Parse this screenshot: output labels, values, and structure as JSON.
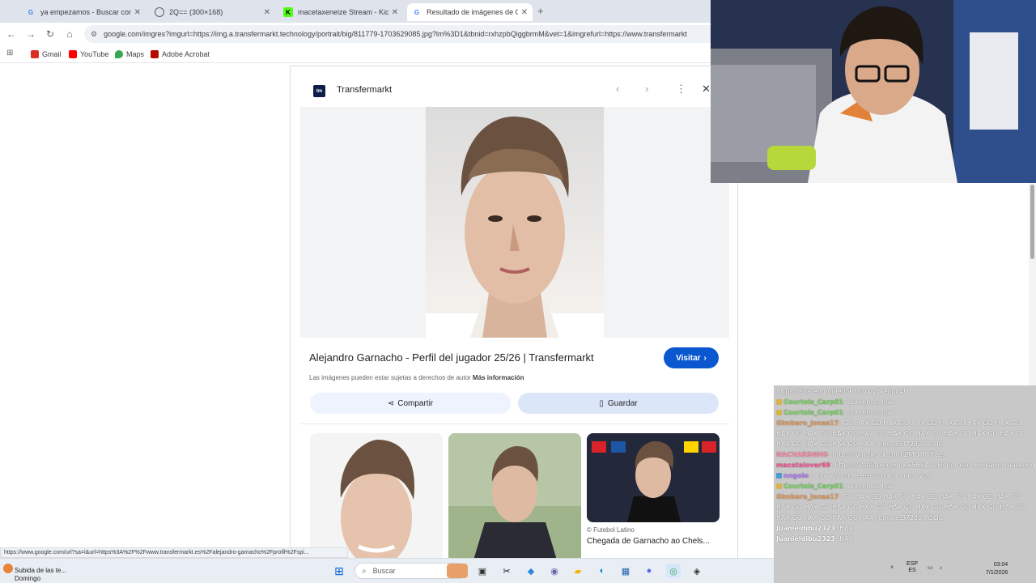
{
  "browser": {
    "tabs": [
      {
        "label": "ya empezamos - Buscar con Go",
        "icon": "google-icon",
        "active": false
      },
      {
        "label": "2Q== (300×168)",
        "icon": "globe-icon",
        "active": false
      },
      {
        "label": "macetaxeneize Stream - Kick D",
        "icon": "kick-icon",
        "active": false
      },
      {
        "label": "Resultado de imágenes de Go",
        "icon": "google-icon",
        "active": true
      }
    ],
    "url": "google.com/imgres?imgurl=https://img.a.transfermarkt.technology/portrait/big/811779-1703629085.jpg?lm%3D1&tbnid=rxhzpbQiggbrmM&vet=1&imgrefurl=https://www.transfermarkt",
    "bookmarks": [
      {
        "label": "Gmail",
        "icon": "gmail-icon",
        "color": "#d93025"
      },
      {
        "label": "YouTube",
        "icon": "youtube-icon",
        "color": "#ff0000"
      },
      {
        "label": "Maps",
        "icon": "maps-icon",
        "color": "#34a853"
      },
      {
        "label": "Adobe Acrobat",
        "icon": "acrobat-icon",
        "color": "#b30b00"
      }
    ],
    "status_url": "https://www.google.com/url?sa=i&url=https%3A%2F%2Fwww.transfermarkt.es%2Falejandro-garnacho%2Fprofil%2Fspi..."
  },
  "panel": {
    "site_logo": "tm",
    "site_name": "Transfermarkt",
    "title": "Alejandro Garnacho - Perfil del jugador 25/26 | Transfermarkt",
    "visit_label": "Visitar",
    "copyright_text": "Las imágenes pueden estar sujetas a derechos de autor",
    "more_info": "Más información",
    "share_label": "Compartir",
    "save_label": "Guardar",
    "related_source": "Futebol Latino",
    "related_title": "Chegada de Garnacho ao Chels..."
  },
  "chat": [
    {
      "user": "",
      "text": "https://share.google/loP7yivwv5xexpo4U"
    },
    {
      "user": "Courtois_Carp01",
      "text": ": queremos hax",
      "badge": "#d8b24a"
    },
    {
      "user": "Courtois_Carp01",
      "text": ": queremos hax",
      "badge": "#d8b24a"
    },
    {
      "user": "Gimbaro_jonas17",
      "text": ": GO HAX  GO HAX  GO HAX  GO HAX  GO HAX  GO HAX  GO HAX  GO HAX  GO HAX  GO HAX  GO HAX  GO HAX  GO HAX  GO HAX  GO HAX  GO HAX  GO HAX  GO HAX  GO HAX [emote:37230:POLIC",
      "wrap": true
    },
    {
      "user": "NACHARBNHO",
      "text": ": https://vm.tiktok.com/ZMOMfkTde/"
    },
    {
      "user": "macetalover69",
      "text": ": https://vt.tiktok.com/ZS5HSAUvH/ por eso me llamo macelover"
    },
    {
      "user": "nngolo",
      "text": ": mira wsp se te escuchaba mal a vos",
      "badge": "#4a9bd8"
    },
    {
      "user": "Courtois_Carp01",
      "text": ": queremos hax",
      "badge": "#d8b24a"
    },
    {
      "user": "Gimbaro_jonas17",
      "text": ": GO HAX  GO HAX  GO HAX  GO HAX  GO HAX  GO HAX  GO HAX  GO HAX  GO HAX  GO HAX  GO HAX  GO HAX  GO HAX  GO HAX  GO HAX  GO HAX  GO HAX  GO HAX  GO HAX [emote:37230:POLIC",
      "wrap": true
    },
    {
      "user": "Juanieldibu2323",
      "text": ": HAX"
    },
    {
      "user": "Juanieldibu2323",
      "text": ": HAX"
    }
  ],
  "taskbar": {
    "weather_line1": "Subida de las te...",
    "weather_line2": "Domingo",
    "search_placeholder": "Buscar",
    "tray_lang": "ESP",
    "tray_region": "ES",
    "time": "03:04",
    "date": "7/1/2026"
  },
  "colors": {
    "accent": "#0b57d0",
    "tab_bg": "#dfe3eb",
    "chat_bg": "#c6c6c6"
  }
}
